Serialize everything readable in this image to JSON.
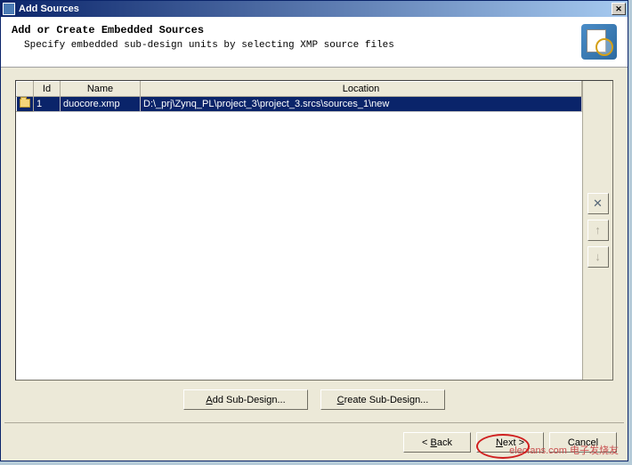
{
  "window": {
    "title": "Add Sources"
  },
  "header": {
    "title": "Add or Create Embedded Sources",
    "description": "Specify embedded sub-design units by selecting XMP source files"
  },
  "grid": {
    "columns": {
      "id": "Id",
      "name": "Name",
      "location": "Location"
    },
    "rows": [
      {
        "id": "1",
        "name": "duocore.xmp",
        "location": "D:\\_prj\\Zynq_PL\\project_3\\project_3.srcs\\sources_1\\new"
      }
    ]
  },
  "side": {
    "remove": "✕",
    "up": "↑",
    "down": "↓"
  },
  "buttons": {
    "add": {
      "pre": "",
      "u": "A",
      "post": "dd Sub-Design..."
    },
    "create": {
      "pre": "",
      "u": "C",
      "post": "reate Sub-Design..."
    }
  },
  "nav": {
    "back": {
      "pre": "< ",
      "u": "B",
      "post": "ack"
    },
    "next": {
      "pre": "",
      "u": "N",
      "post": "ext >"
    },
    "cancel": {
      "label": "Cancel"
    }
  },
  "watermark": {
    "text": "elecfans.com  电子发烧友"
  }
}
